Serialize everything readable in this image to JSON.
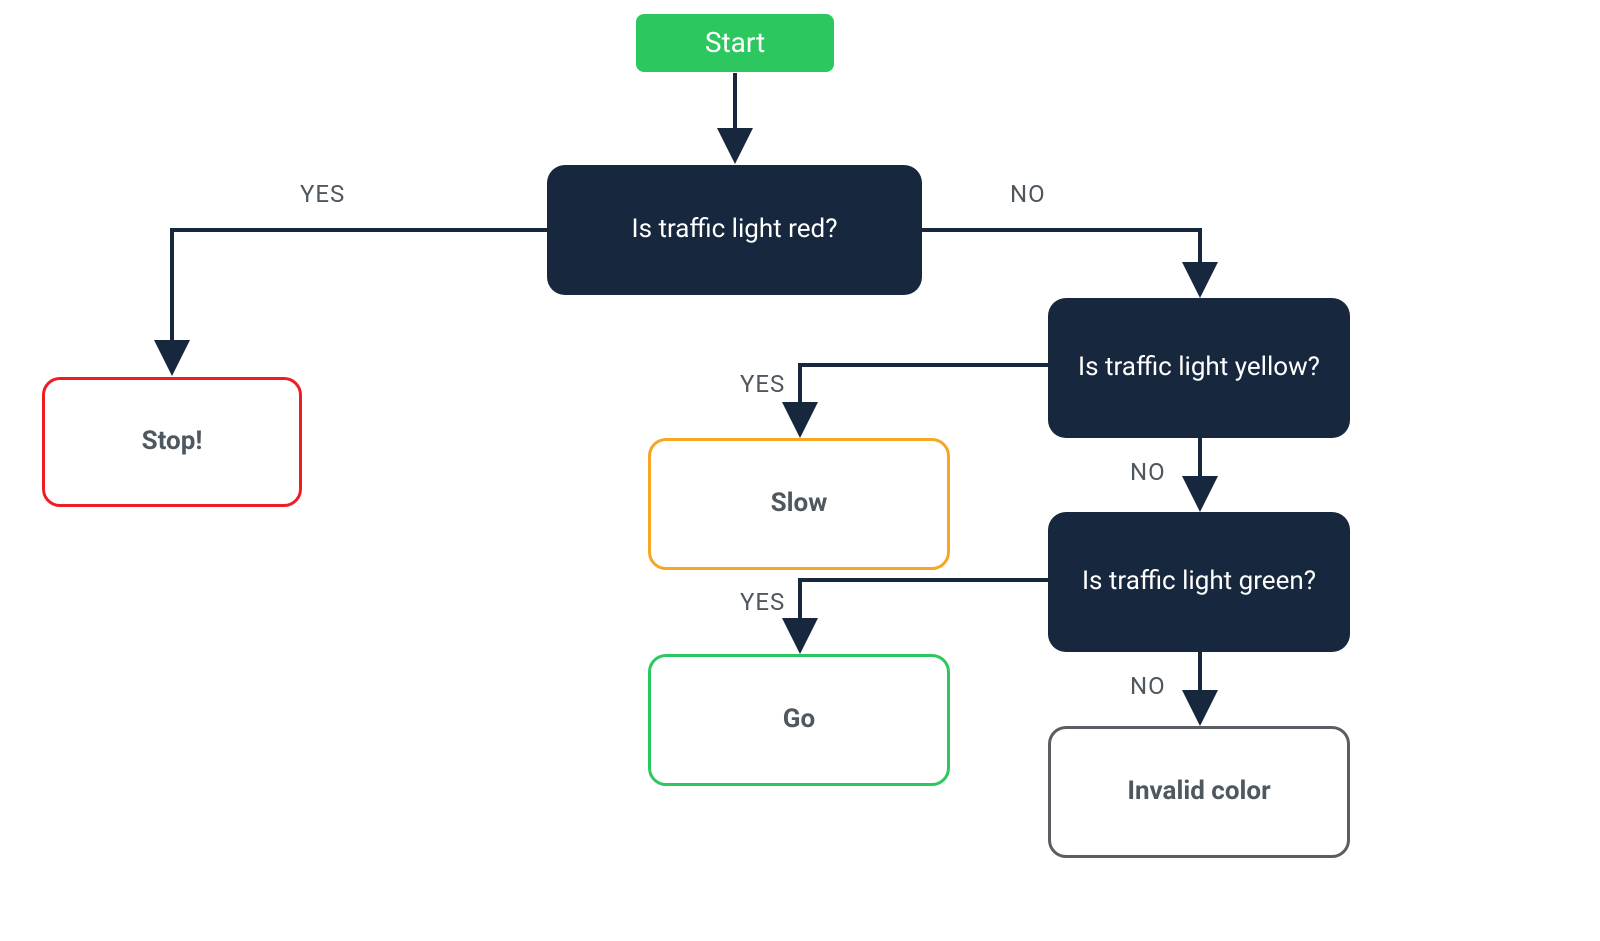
{
  "nodes": {
    "start": "Start",
    "q_red": "Is traffic light red?",
    "q_yellow": "Is traffic light yellow?",
    "q_green": "Is traffic light green?",
    "stop": "Stop!",
    "slow": "Slow",
    "go": "Go",
    "invalid": "Invalid color"
  },
  "labels": {
    "yes": "YES",
    "no": "NO"
  },
  "colors": {
    "start_bg": "#2dc760",
    "decision_bg": "#17273e",
    "stop_border": "#ee1d23",
    "slow_border": "#f6a623",
    "go_border": "#2dc760",
    "invalid_border": "#5a5e63",
    "connector": "#17273e",
    "label_text": "#4f575f"
  }
}
